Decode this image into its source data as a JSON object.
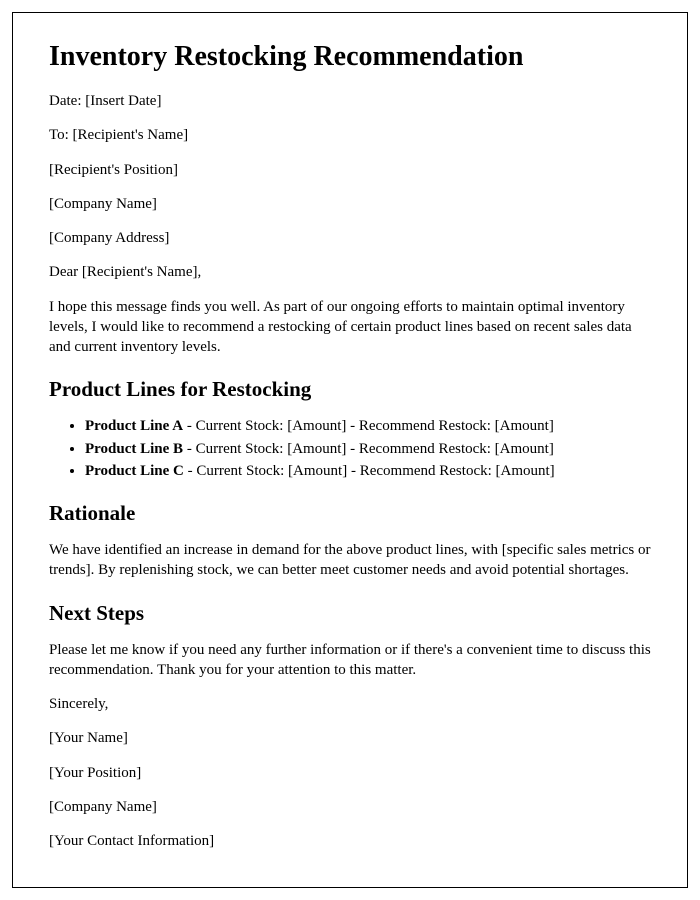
{
  "title": "Inventory Restocking Recommendation",
  "header": {
    "date_line": "Date: [Insert Date]",
    "to_line": "To: [Recipient's Name]",
    "position_line": "[Recipient's Position]",
    "company_line": "[Company Name]",
    "address_line": "[Company Address]"
  },
  "salutation": "Dear [Recipient's Name],",
  "intro_paragraph": "I hope this message finds you well. As part of our ongoing efforts to maintain optimal inventory levels, I would like to recommend a restocking of certain product lines based on recent sales data and current inventory levels.",
  "section_products": {
    "heading": "Product Lines for Restocking",
    "items": [
      {
        "name": "Product Line A",
        "detail": " - Current Stock: [Amount] - Recommend Restock: [Amount]"
      },
      {
        "name": "Product Line B",
        "detail": " - Current Stock: [Amount] - Recommend Restock: [Amount]"
      },
      {
        "name": "Product Line C",
        "detail": " - Current Stock: [Amount] - Recommend Restock: [Amount]"
      }
    ]
  },
  "section_rationale": {
    "heading": "Rationale",
    "body": "We have identified an increase in demand for the above product lines, with [specific sales metrics or trends]. By replenishing stock, we can better meet customer needs and avoid potential shortages."
  },
  "section_next_steps": {
    "heading": "Next Steps",
    "body": "Please let me know if you need any further information or if there's a convenient time to discuss this recommendation. Thank you for your attention to this matter."
  },
  "closing": {
    "sincerely": "Sincerely,",
    "your_name": "[Your Name]",
    "your_position": "[Your Position]",
    "your_company": "[Company Name]",
    "your_contact": "[Your Contact Information]"
  }
}
